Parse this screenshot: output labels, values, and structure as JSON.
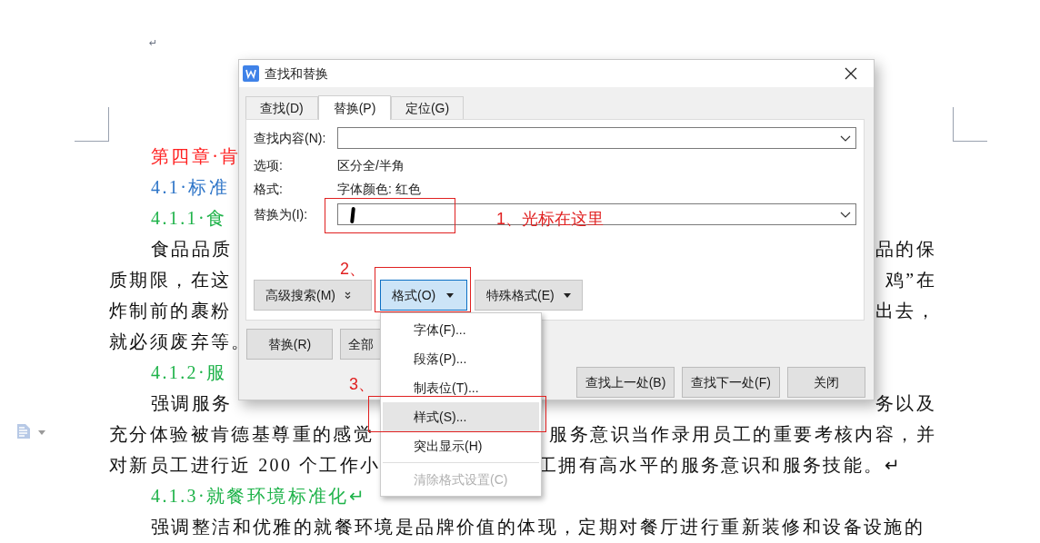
{
  "document": {
    "lines": [
      {
        "kind": "mark",
        "left": "↵"
      },
      {
        "kind": "heading",
        "color": "#ff2020",
        "left": "第四章·肯"
      },
      {
        "kind": "heading",
        "color": "#2e75c8",
        "left": "4.1·标准"
      },
      {
        "kind": "heading",
        "color": "#1fb34a",
        "left": "4.1.1·食"
      },
      {
        "kind": "first",
        "left": "食品品质",
        "right": "品的保"
      },
      {
        "kind": "body",
        "left": "质期限，在这",
        "right": "鸡”在"
      },
      {
        "kind": "body",
        "left": "炸制前的裹粉",
        "right": "出去，"
      },
      {
        "kind": "body",
        "left": "就必须废弃等。"
      },
      {
        "kind": "heading",
        "color": "#1fb34a",
        "left": "4.1.2·服"
      },
      {
        "kind": "first",
        "left": "强调服务",
        "right": "务以及"
      },
      {
        "kind": "body",
        "left": "充分体验被肯德基尊重的感觉",
        "right": "服务意识当作录用员工的重要考核内容，并"
      },
      {
        "kind": "last",
        "left": "对新员工进行近 200 个工作小",
        "right": "工拥有高水平的服务意识和服务技能。↵"
      },
      {
        "kind": "heading",
        "color": "#1fb34a",
        "left": "4.1.3·就餐环境标准化↵"
      },
      {
        "kind": "first",
        "left": "强调整洁和优雅的就餐环境是品牌价值的体现，定期对餐厅进行重新装修和设备设施的"
      }
    ]
  },
  "dialog": {
    "title": "查找和替换",
    "tabs": [
      {
        "label": "查找(D)",
        "selected": false
      },
      {
        "label": "替换(P)",
        "selected": true
      },
      {
        "label": "定位(G)",
        "selected": false
      }
    ],
    "find": {
      "label": "查找内容(N):"
    },
    "options": {
      "label": "选项:",
      "value": "区分全/半角"
    },
    "format": {
      "label": "格式:",
      "value": "字体颜色: 红色"
    },
    "replace": {
      "label": "替换为(I):",
      "focused": true,
      "annotation": "1、光标在这里"
    },
    "tool_buttons": [
      {
        "label": "高级搜索(M)",
        "kind": "expand",
        "pressed": false
      },
      {
        "label": "格式(O)",
        "kind": "dropdown",
        "pressed": true,
        "annotation": "2、"
      },
      {
        "label": "特殊格式(E)",
        "kind": "dropdown",
        "pressed": false
      }
    ],
    "action_buttons": [
      "替换(R)",
      "全部"
    ],
    "nav_buttons": [
      "查找上一处(B)",
      "查找下一处(F)",
      "关闭"
    ]
  },
  "menu": {
    "items": [
      {
        "kind": "item",
        "label": "字体(F)...",
        "highlighted": false,
        "disabled": false
      },
      {
        "kind": "item",
        "label": "段落(P)...",
        "highlighted": false,
        "disabled": false
      },
      {
        "kind": "item",
        "label": "制表位(T)...",
        "highlighted": false,
        "disabled": false
      },
      {
        "kind": "item",
        "label": "样式(S)...",
        "highlighted": true,
        "disabled": false,
        "annotation": "3、"
      },
      {
        "kind": "item",
        "label": "突出显示(H)",
        "highlighted": false,
        "disabled": false
      },
      {
        "kind": "separator"
      },
      {
        "kind": "item",
        "label": "清除格式设置(C)",
        "highlighted": false,
        "disabled": true
      }
    ]
  }
}
